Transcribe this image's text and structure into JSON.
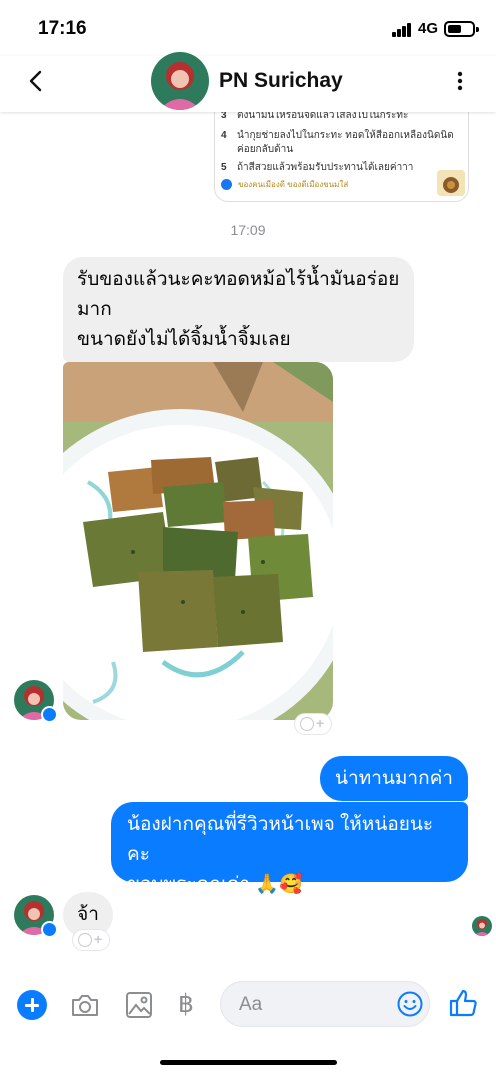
{
  "status_bar": {
    "time": "17:16",
    "network": "4G",
    "battery_level": 0.55
  },
  "header": {
    "contact_name": "PN Surichay"
  },
  "shared_post": {
    "lines": [
      {
        "num": "3",
        "text": "ตั้งน้ำมันให้ร้อนจัดแล้วใส่ลงไปในกระทะ"
      },
      {
        "num": "4",
        "text": "นำกุยช่ายลงไปในกระทะ ทอดให้สีออกเหลืองนิดนิด"
      },
      {
        "num": "",
        "text": "ค่อยกลับด้าน"
      },
      {
        "num": "5",
        "text": "ถ้าสีสวยแล้วพร้อมรับประทานได้เลยค่าาา"
      }
    ],
    "footer": "ของคนเมืองดี ของดีเมืองขนมใส่"
  },
  "timestamp": "17:09",
  "messages": {
    "incoming_1": {
      "line1": "รับของแล้วนะคะทอดหม้อไร้น้ำมันอร่อย",
      "line2": "มาก",
      "line3": "ขนาดยังไม่ได้จิ้มน้ำจิ้มเลย"
    },
    "outgoing_1": {
      "text": "น่าทานมากค่า"
    },
    "outgoing_2": {
      "line1": "น้องฝากคุณพี่รีวิวหน้าเพจ ให้หน่อยนะคะ",
      "line2": "ขอบพระคุณค่า 🙏🥰"
    },
    "incoming_2": {
      "text": "จ้า"
    }
  },
  "composer": {
    "placeholder": "Aa",
    "value": "",
    "baht_symbol": "฿"
  },
  "colors": {
    "accent": "#0a7cff",
    "incoming_bubble": "#efeff0",
    "muted": "#8a8d91"
  }
}
